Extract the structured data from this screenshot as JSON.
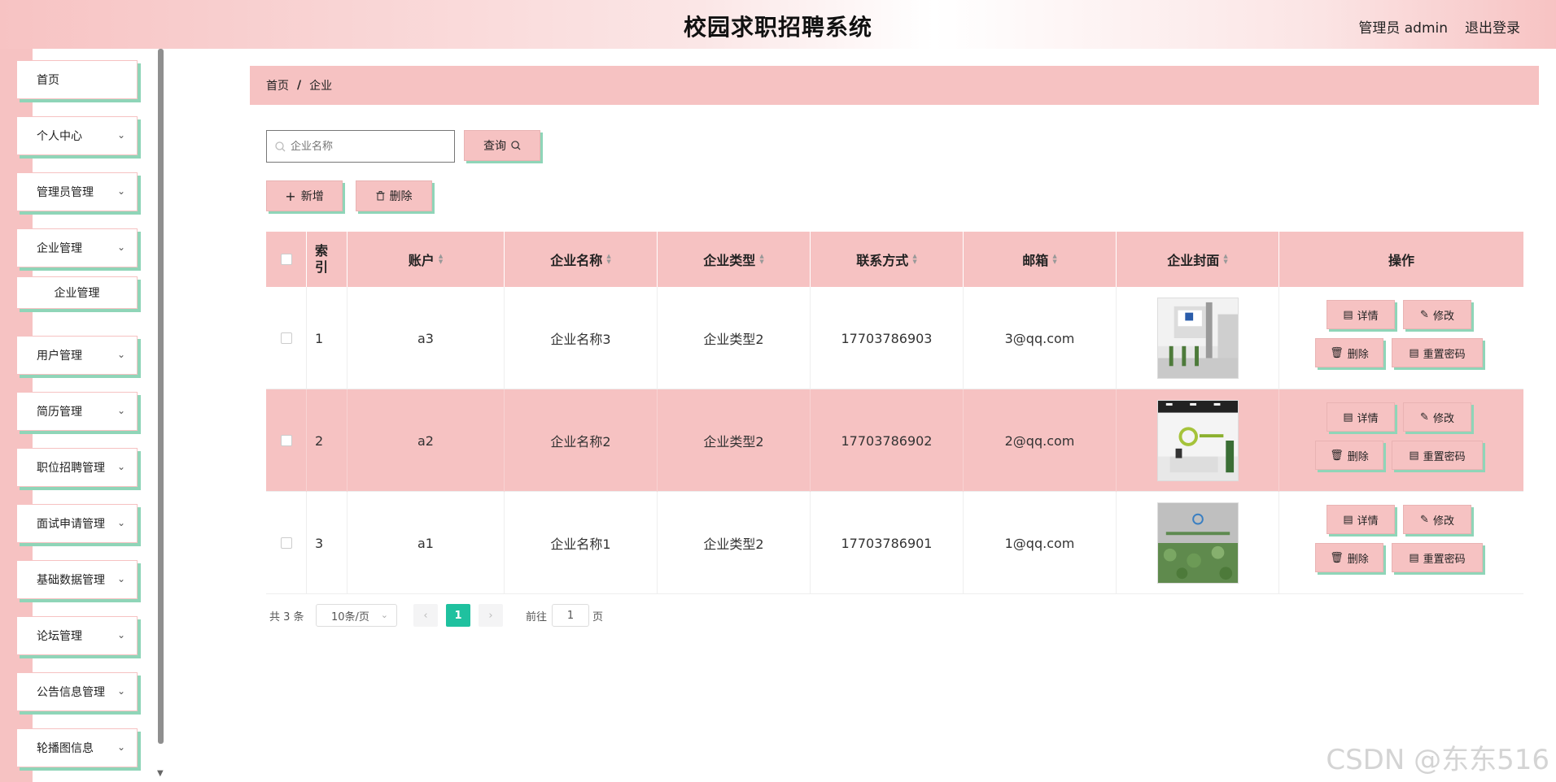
{
  "header": {
    "title": "校园求职招聘系统",
    "user": "管理员 admin",
    "logout": "退出登录"
  },
  "sidebar": {
    "items": [
      {
        "label": "首页",
        "chevron": false
      },
      {
        "label": "个人中心",
        "chevron": true
      },
      {
        "label": "管理员管理",
        "chevron": true
      },
      {
        "label": "企业管理",
        "chevron": true
      },
      {
        "label": "用户管理",
        "chevron": true
      },
      {
        "label": "简历管理",
        "chevron": true
      },
      {
        "label": "职位招聘管理",
        "chevron": true
      },
      {
        "label": "面试申请管理",
        "chevron": true
      },
      {
        "label": "基础数据管理",
        "chevron": true
      },
      {
        "label": "论坛管理",
        "chevron": true
      },
      {
        "label": "公告信息管理",
        "chevron": true
      },
      {
        "label": "轮播图信息",
        "chevron": true
      }
    ],
    "submenu": "企业管理"
  },
  "breadcrumb": {
    "home": "首页",
    "sep": "/",
    "current": "企业"
  },
  "search": {
    "placeholder": "企业名称",
    "button": "查询"
  },
  "actions": {
    "add": "新增",
    "delete": "删除"
  },
  "table": {
    "headers": [
      "索引",
      "账户",
      "企业名称",
      "企业类型",
      "联系方式",
      "邮箱",
      "企业封面",
      "操作"
    ],
    "rows": [
      {
        "index": "1",
        "account": "a3",
        "name": "企业名称3",
        "type": "企业类型2",
        "phone": "17703786903",
        "email": "3@qq.com"
      },
      {
        "index": "2",
        "account": "a2",
        "name": "企业名称2",
        "type": "企业类型2",
        "phone": "17703786902",
        "email": "2@qq.com"
      },
      {
        "index": "3",
        "account": "a1",
        "name": "企业名称1",
        "type": "企业类型2",
        "phone": "17703786901",
        "email": "1@qq.com"
      }
    ],
    "ops": {
      "detail": "详情",
      "edit": "修改",
      "delete": "删除",
      "reset": "重置密码"
    }
  },
  "pagination": {
    "total": "共 3 条",
    "size": "10条/页",
    "current": "1",
    "goto": "前往",
    "page_input": "1",
    "page_unit": "页"
  },
  "watermark": "CSDN @东东516"
}
